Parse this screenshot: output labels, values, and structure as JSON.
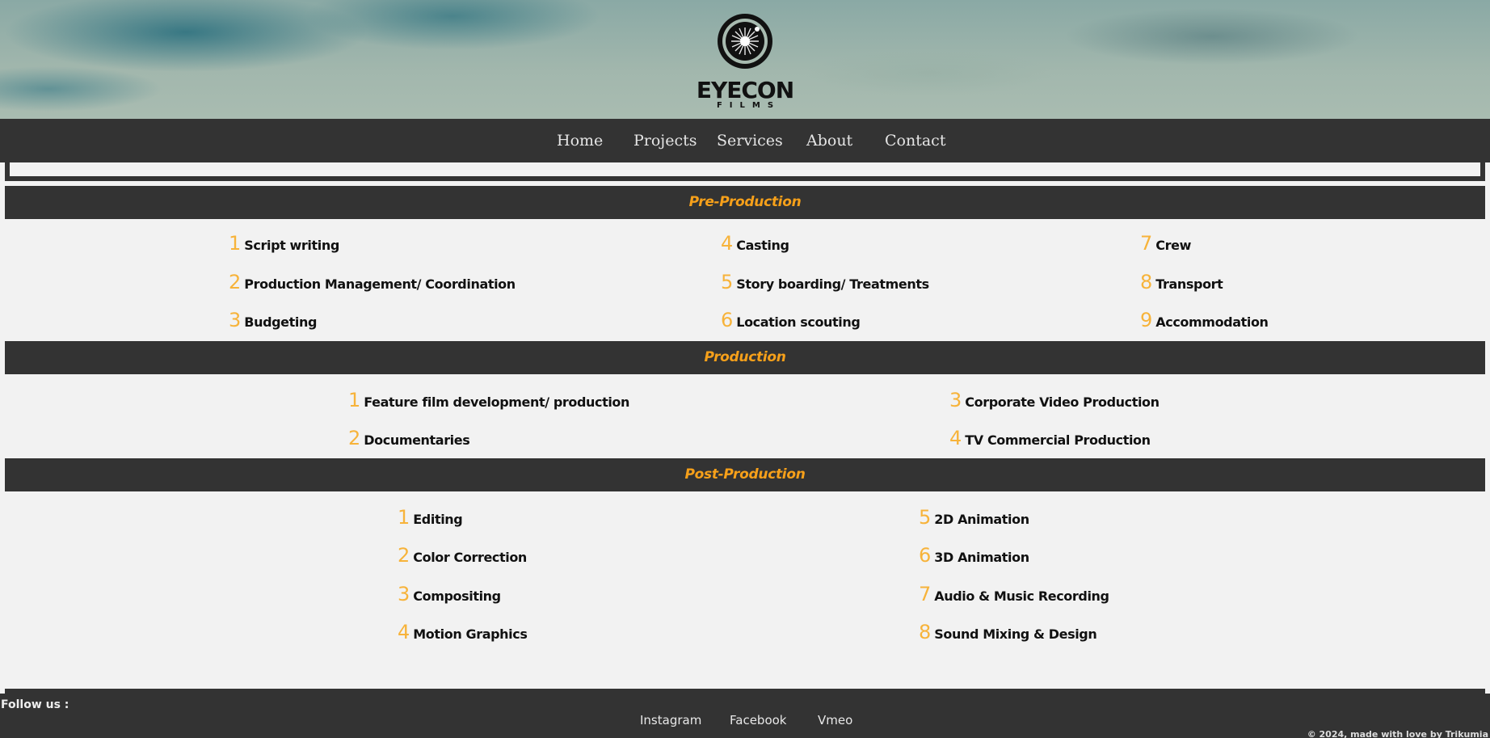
{
  "brand": {
    "name": "EYECON",
    "sub": "FILMS"
  },
  "nav": {
    "home": "Home",
    "projects": "Projects",
    "services": "Services",
    "about": "About",
    "contact": "Contact"
  },
  "colors": {
    "dark": "#333333",
    "accent": "#f6a01a",
    "number": "#f7b33a",
    "background": "#f2f2f2"
  },
  "sections": [
    {
      "title": "Pre-Production",
      "items": [
        {
          "num": "1",
          "label": "Script writing"
        },
        {
          "num": "2",
          "label": "Production Management/ Coordination"
        },
        {
          "num": "3",
          "label": "Budgeting"
        },
        {
          "num": "4",
          "label": "Casting"
        },
        {
          "num": "5",
          "label": "Story boarding/ Treatments"
        },
        {
          "num": "6",
          "label": "Location scouting"
        },
        {
          "num": "7",
          "label": "Crew"
        },
        {
          "num": "8",
          "label": "Transport"
        },
        {
          "num": "9",
          "label": "Accommodation"
        }
      ]
    },
    {
      "title": "Production",
      "items": [
        {
          "num": "1",
          "label": "Feature film development/ production"
        },
        {
          "num": "2",
          "label": "Documentaries"
        },
        {
          "num": "3",
          "label": "Corporate Video Production"
        },
        {
          "num": "4",
          "label": "TV Commercial Production"
        }
      ]
    },
    {
      "title": "Post-Production",
      "items": [
        {
          "num": "1",
          "label": "Editing"
        },
        {
          "num": "2",
          "label": "Color Correction"
        },
        {
          "num": "3",
          "label": "Compositing"
        },
        {
          "num": "4",
          "label": "Motion Graphics"
        },
        {
          "num": "5",
          "label": "2D Animation"
        },
        {
          "num": "6",
          "label": "3D Animation"
        },
        {
          "num": "7",
          "label": "Audio & Music Recording"
        },
        {
          "num": "8",
          "label": "Sound Mixing & Design"
        }
      ]
    }
  ],
  "footer": {
    "follow": "Follow us :",
    "instagram": "Instagram",
    "facebook": "Facebook",
    "vimeo": "Vmeo",
    "copyright": "© 2024, made with love by Trikumia"
  }
}
